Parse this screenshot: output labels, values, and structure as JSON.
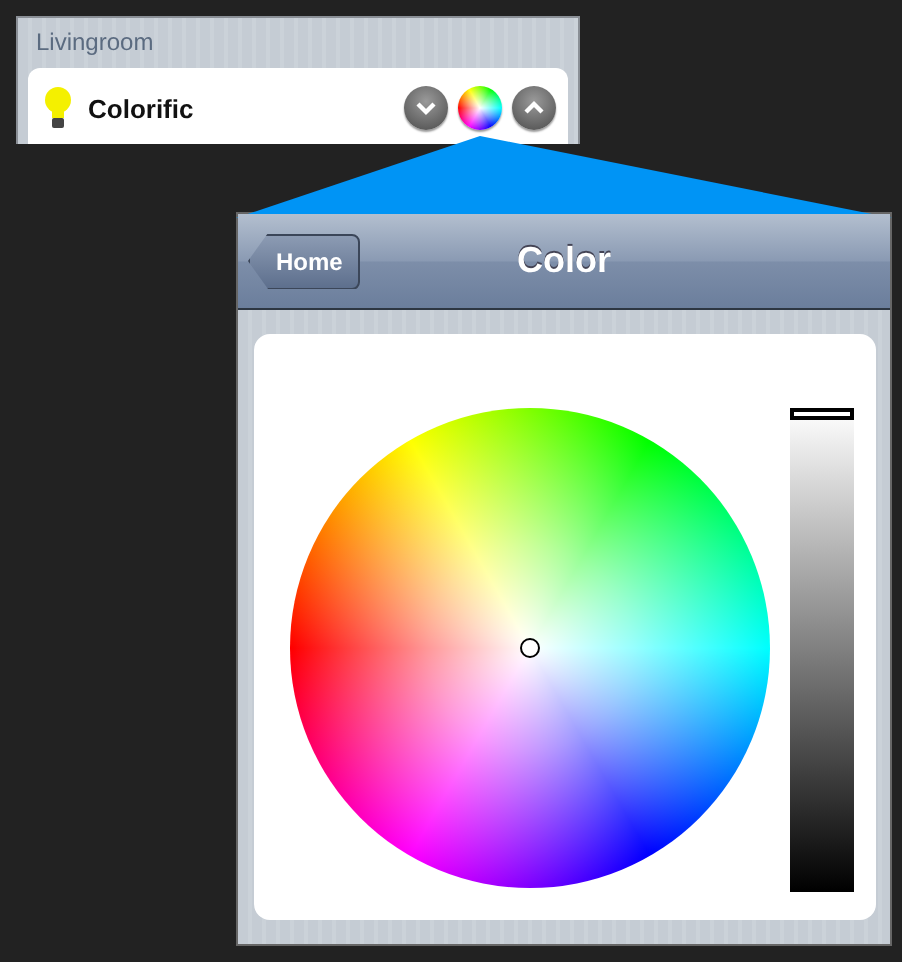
{
  "room": {
    "title": "Livingroom"
  },
  "device": {
    "name": "Colorific",
    "buttons": [
      {
        "kind": "down"
      },
      {
        "kind": "color"
      },
      {
        "kind": "up"
      }
    ]
  },
  "popup": {
    "back_button": "Home",
    "title": "Color",
    "brightness": {
      "level": 1
    }
  }
}
